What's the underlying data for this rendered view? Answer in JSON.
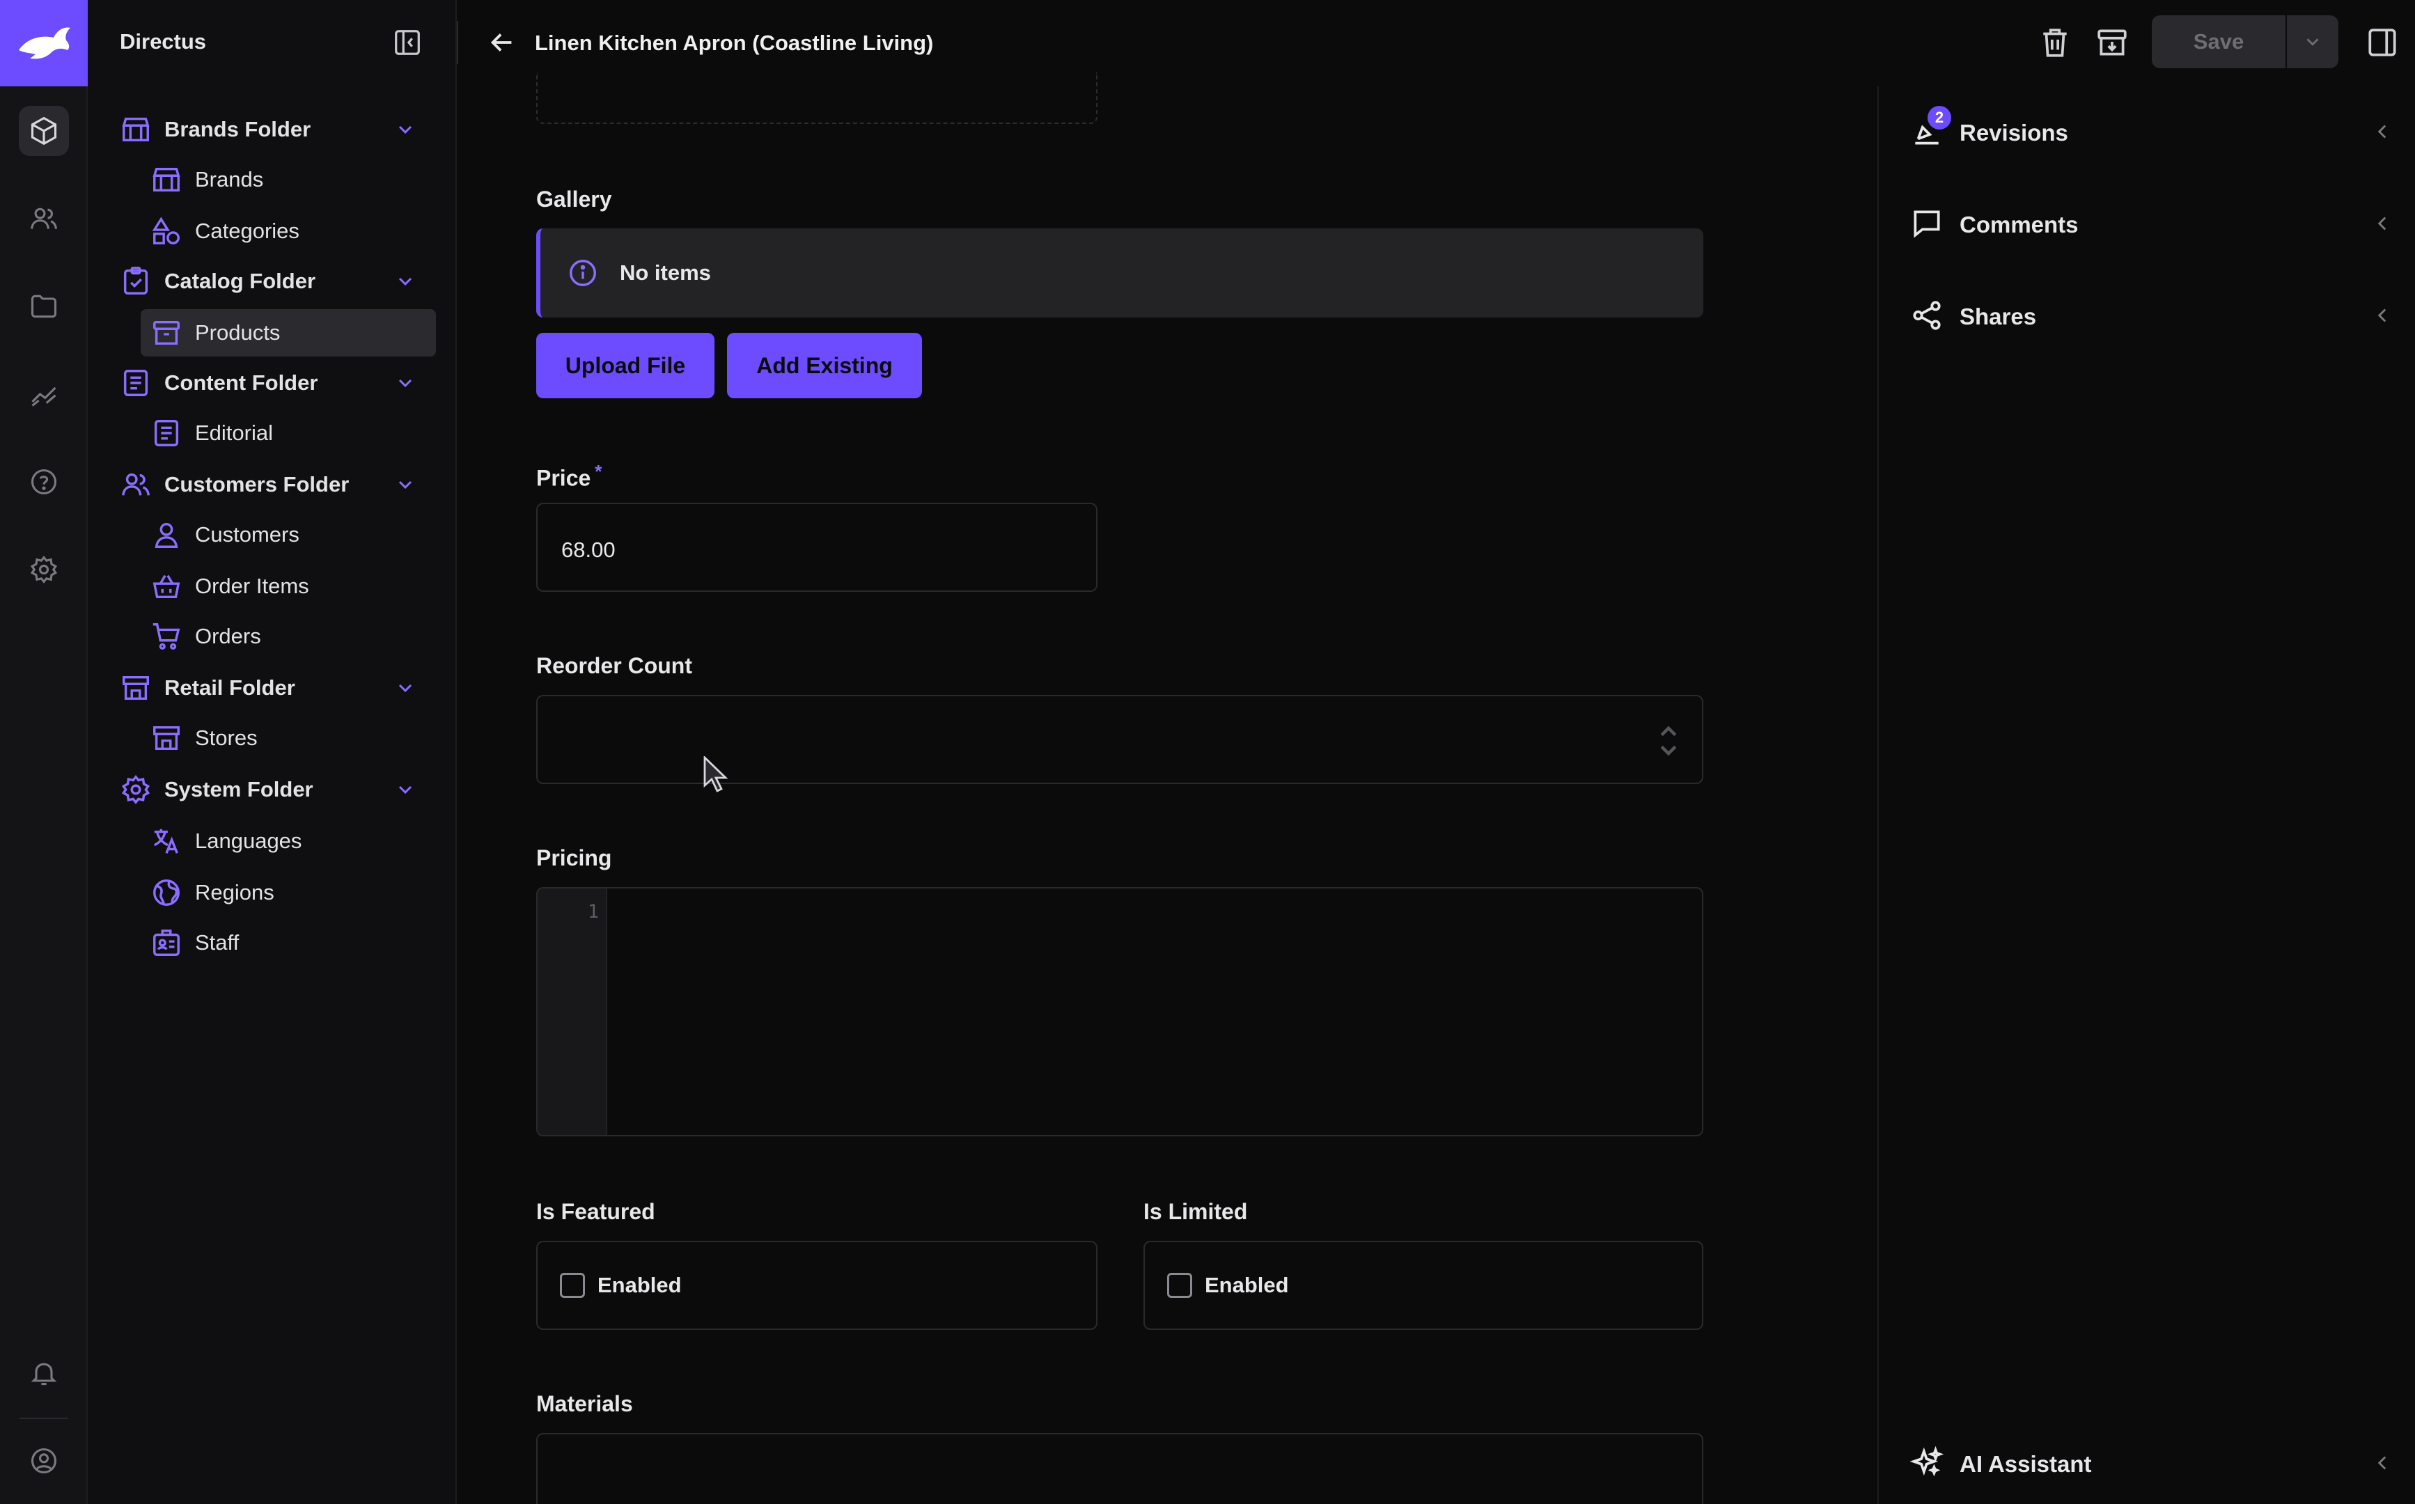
{
  "app": {
    "project_name": "Directus",
    "item_title": "Linen Kitchen Apron (Coastline Living)"
  },
  "colors": {
    "accent": "#6d4cff",
    "background": "#0b0b0c",
    "panel": "#232326"
  },
  "header": {
    "save_label": "Save"
  },
  "navigation": {
    "items": [
      {
        "label": "Brands Folder",
        "icon": "store-icon",
        "type": "folder"
      },
      {
        "label": "Brands",
        "icon": "store-icon",
        "type": "child"
      },
      {
        "label": "Categories",
        "icon": "shapes-icon",
        "type": "child"
      },
      {
        "label": "Catalog Folder",
        "icon": "clipboard-check-icon",
        "type": "folder"
      },
      {
        "label": "Products",
        "icon": "archive-box-icon",
        "type": "child",
        "active": true
      },
      {
        "label": "Content Folder",
        "icon": "article-icon",
        "type": "folder"
      },
      {
        "label": "Editorial",
        "icon": "article-icon",
        "type": "child"
      },
      {
        "label": "Customers Folder",
        "icon": "users-icon",
        "type": "folder"
      },
      {
        "label": "Customers",
        "icon": "person-icon",
        "type": "child"
      },
      {
        "label": "Order Items",
        "icon": "basket-icon",
        "type": "child"
      },
      {
        "label": "Orders",
        "icon": "cart-icon",
        "type": "child"
      },
      {
        "label": "Retail Folder",
        "icon": "storefront-icon",
        "type": "folder"
      },
      {
        "label": "Stores",
        "icon": "storefront-icon",
        "type": "child"
      },
      {
        "label": "System Folder",
        "icon": "gear-icon",
        "type": "folder"
      },
      {
        "label": "Languages",
        "icon": "translate-icon",
        "type": "child"
      },
      {
        "label": "Regions",
        "icon": "globe-icon",
        "type": "child"
      },
      {
        "label": "Staff",
        "icon": "badge-id-icon",
        "type": "child"
      }
    ]
  },
  "form": {
    "gallery": {
      "label": "Gallery",
      "notice": "No items",
      "upload_label": "Upload File",
      "add_existing_label": "Add Existing"
    },
    "price": {
      "label": "Price",
      "required_mark": "*",
      "value": "68.00"
    },
    "reorder_count": {
      "label": "Reorder Count",
      "value": ""
    },
    "pricing": {
      "label": "Pricing",
      "line_number": "1"
    },
    "is_featured": {
      "label": "Is Featured",
      "checkbox_label": "Enabled",
      "checked": false
    },
    "is_limited": {
      "label": "Is Limited",
      "checkbox_label": "Enabled",
      "checked": false
    },
    "materials": {
      "label": "Materials"
    }
  },
  "sidebar": {
    "revisions": {
      "label": "Revisions",
      "badge": "2"
    },
    "comments": {
      "label": "Comments"
    },
    "shares": {
      "label": "Shares"
    },
    "ai_assistant": {
      "label": "AI Assistant"
    }
  }
}
